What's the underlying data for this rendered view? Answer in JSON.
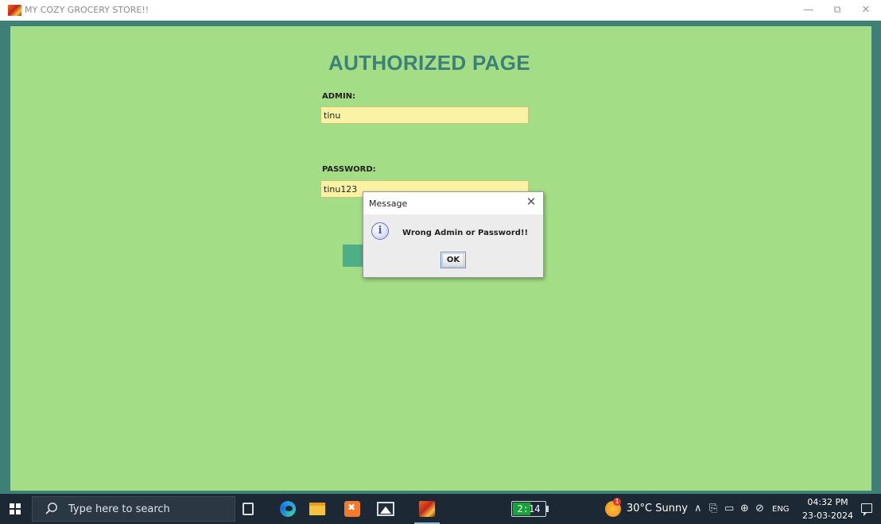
{
  "window": {
    "title": "MY COZY GROCERY STORE!!",
    "minimize_glyph": "—",
    "maximize_glyph": "⧉",
    "close_glyph": "✕",
    "icon": "app-icon"
  },
  "login": {
    "heading": "AUTHORIZED PAGE",
    "admin_label": "ADMIN:",
    "admin_value": "tinu",
    "password_label": "PASSWORD:",
    "password_value": "tinu123"
  },
  "dialog": {
    "title": "Message",
    "close_glyph": "✕",
    "icon_glyph": "i",
    "message": "Wrong Admin or Password!!",
    "ok_label": "OK"
  },
  "taskbar": {
    "search_placeholder": "Type here to search",
    "battery_text": "2:14",
    "battery_level": 0.55,
    "weather_text": "30°C  Sunny",
    "weather_badge": "1",
    "tray_chevron": "∧",
    "tray_pen": "⎘",
    "tray_battery": "▭",
    "tray_network": "⊕",
    "tray_volume": "⊘",
    "language": "ENG",
    "time": "04:32 PM",
    "date": "23-03-2024"
  },
  "colors": {
    "panel_background": "#a3de86",
    "frame": "#3e8075",
    "heading": "#3c8078",
    "field_background": "#fbf3a3",
    "taskbar": "#1c2833"
  }
}
